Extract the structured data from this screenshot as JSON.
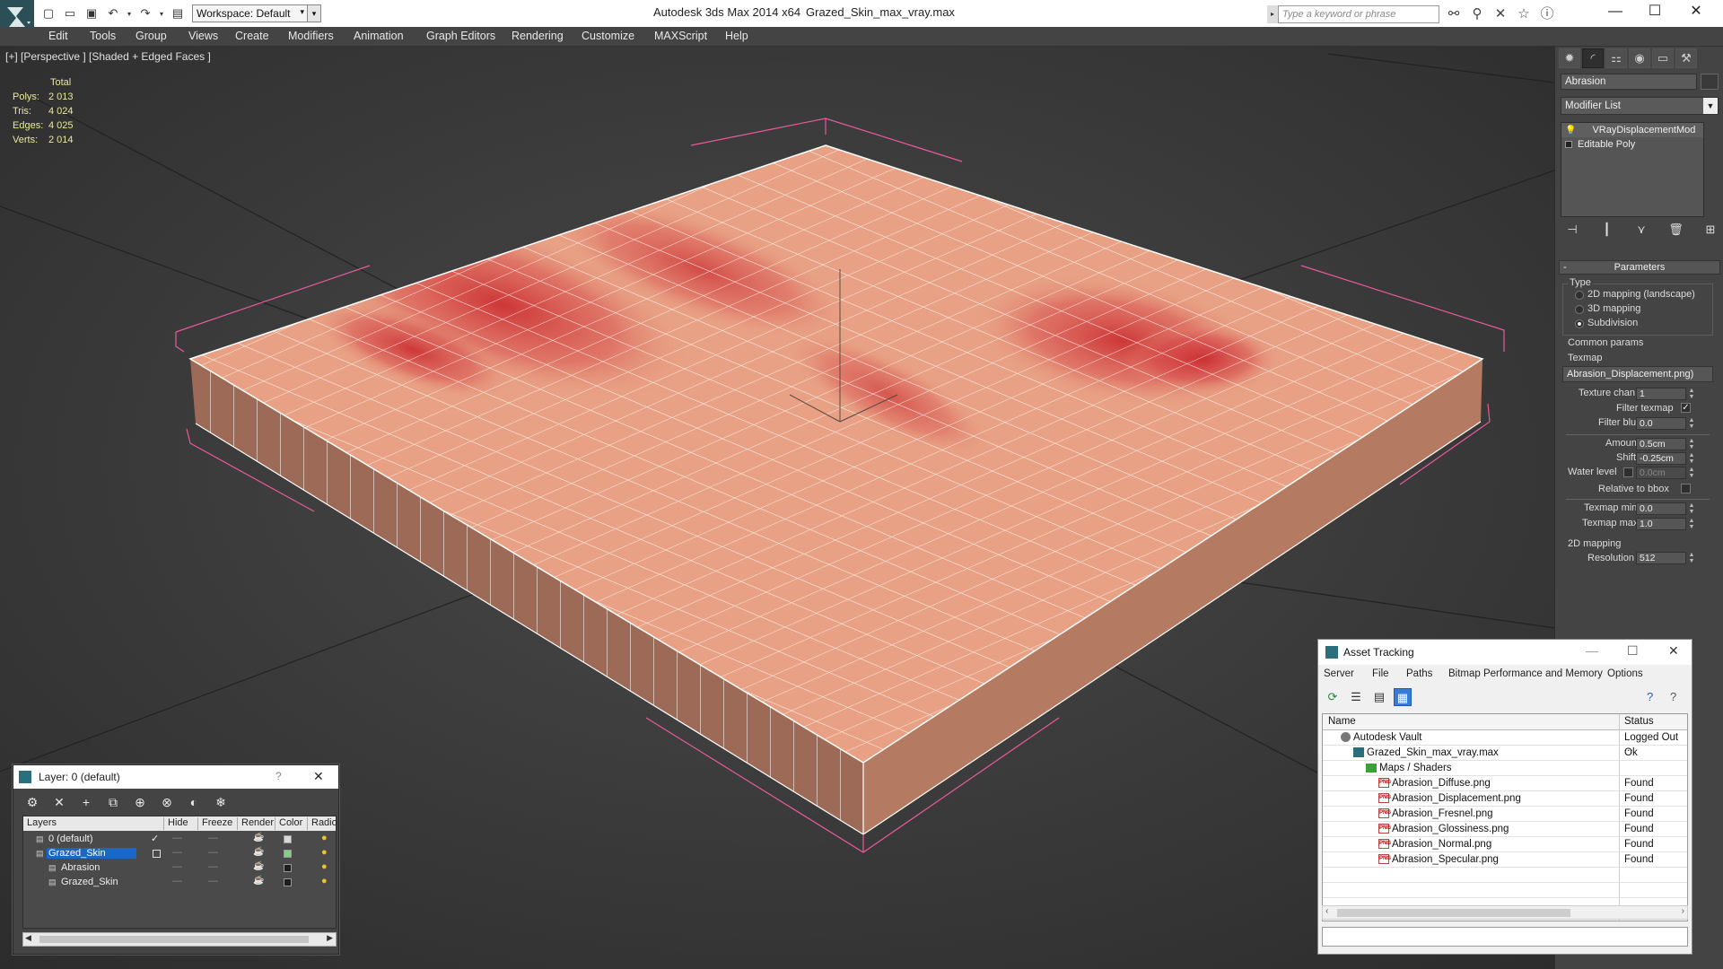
{
  "app": {
    "title": "Autodesk 3ds Max  2014 x64",
    "file": "Grazed_Skin_max_vray.max",
    "workspace": "Workspace: Default",
    "search_placeholder": "Type a keyword or phrase"
  },
  "menu": [
    "Edit",
    "Tools",
    "Group",
    "Views",
    "Create",
    "Modifiers",
    "Animation",
    "Graph Editors",
    "Rendering",
    "Customize",
    "MAXScript",
    "Help"
  ],
  "viewport": {
    "label": "[+] [Perspective ] [Shaded + Edged Faces ]",
    "stats": {
      "header": "Total",
      "rows": [
        {
          "k": "Polys:",
          "v": "2 013"
        },
        {
          "k": "Tris:",
          "v": "4 024"
        },
        {
          "k": "Edges:",
          "v": "4 025"
        },
        {
          "k": "Verts:",
          "v": "2 014"
        }
      ]
    }
  },
  "command_panel": {
    "object_name": "Abrasion",
    "modifier_list": "Modifier List",
    "stack": [
      "VRayDisplacementMod",
      "Editable Poly"
    ],
    "parameters": {
      "title": "Parameters",
      "type_label": "Type",
      "types": [
        "2D mapping (landscape)",
        "3D mapping",
        "Subdivision"
      ],
      "selected_type": "Subdivision",
      "common_params": "Common params",
      "texmap_label": "Texmap",
      "texmap": "Abrasion_Displacement.png)",
      "texture_chan_label": "Texture chan",
      "texture_chan": "1",
      "filter_texmap_label": "Filter texmap",
      "filter_texmap": true,
      "filter_blur_label": "Filter blur",
      "filter_blur": "0.0",
      "amount_label": "Amount",
      "amount": "0.5cm",
      "shift_label": "Shift",
      "shift": "-0.25cm",
      "water_level_label": "Water level",
      "water_level": "0.0cm",
      "relative_bbox_label": "Relative to bbox",
      "texmap_min_label": "Texmap min",
      "texmap_min": "0.0",
      "texmap_max_label": "Texmap max",
      "texmap_max": "1.0",
      "mapping2d_label": "2D mapping",
      "resolution_label": "Resolution",
      "resolution": "512"
    }
  },
  "layer_window": {
    "title": "Layer: 0 (default)",
    "help": "?",
    "columns": [
      "Layers",
      "Hide",
      "Freeze",
      "Render",
      "Color",
      "Radio"
    ],
    "rows": [
      {
        "name": "0 (default)",
        "indent": 0,
        "color": "#d8d8d8",
        "selected": false,
        "active": true
      },
      {
        "name": "Grazed_Skin",
        "indent": 0,
        "color": "#7fd27f",
        "selected": true,
        "active": false
      },
      {
        "name": "Abrasion",
        "indent": 1,
        "color": "#1e1e1e",
        "selected": false,
        "active": false
      },
      {
        "name": "Grazed_Skin",
        "indent": 1,
        "color": "#1e1e1e",
        "selected": false,
        "active": false
      }
    ]
  },
  "asset_tracking": {
    "title": "Asset Tracking",
    "menu": [
      "Server",
      "File",
      "Paths",
      "Bitmap Performance and Memory",
      "Options"
    ],
    "columns": [
      "Name",
      "Status"
    ],
    "rows": [
      {
        "name": "Autodesk Vault",
        "status": "Logged Out ...",
        "indent": 0,
        "icon": "vault"
      },
      {
        "name": "Grazed_Skin_max_vray.max",
        "status": "Ok",
        "indent": 1,
        "icon": "max"
      },
      {
        "name": "Maps / Shaders",
        "status": "",
        "indent": 2,
        "icon": "folder"
      },
      {
        "name": "Abrasion_Diffuse.png",
        "status": "Found",
        "indent": 3,
        "icon": "png"
      },
      {
        "name": "Abrasion_Displacement.png",
        "status": "Found",
        "indent": 3,
        "icon": "png"
      },
      {
        "name": "Abrasion_Fresnel.png",
        "status": "Found",
        "indent": 3,
        "icon": "png"
      },
      {
        "name": "Abrasion_Glossiness.png",
        "status": "Found",
        "indent": 3,
        "icon": "png"
      },
      {
        "name": "Abrasion_Normal.png",
        "status": "Found",
        "indent": 3,
        "icon": "png"
      },
      {
        "name": "Abrasion_Specular.png",
        "status": "Found",
        "indent": 3,
        "icon": "png"
      }
    ]
  },
  "colors": {
    "skin": "#e8a184",
    "wound": "#c8242a",
    "selection_box": "#e85a9a",
    "stats": "#e8e8a0",
    "selection": "#1a67c7"
  }
}
